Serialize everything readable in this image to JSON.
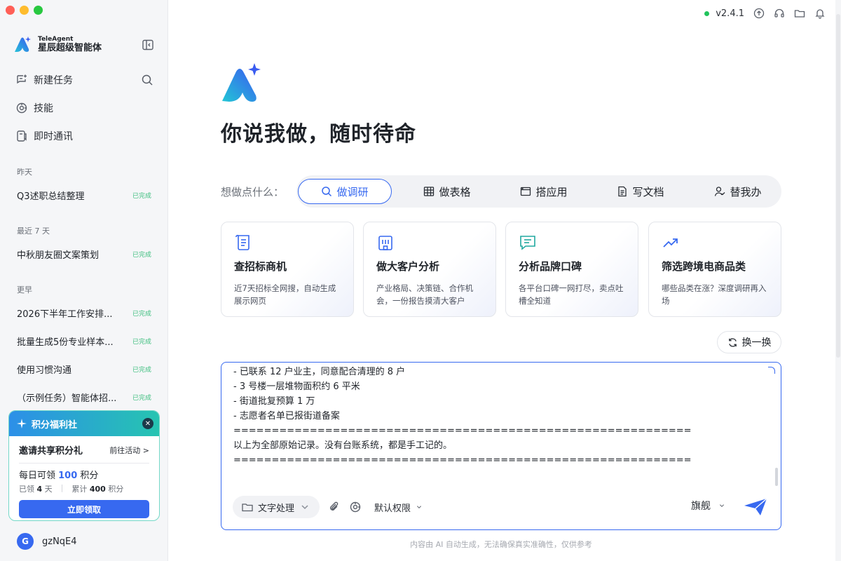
{
  "app": {
    "brand_en": "TeleAgent",
    "brand_cn": "星辰超级智能体",
    "version": "v2.4.1",
    "status_color": "#21c35c"
  },
  "sidebar": {
    "nav": [
      {
        "label": "新建任务",
        "icon": "new-task-icon"
      },
      {
        "label": "技能",
        "icon": "skill-icon"
      },
      {
        "label": "即时通讯",
        "icon": "chat-icon"
      }
    ],
    "sections": [
      {
        "label": "昨天",
        "items": [
          {
            "title": "Q3述职总结整理",
            "status": "已完成"
          }
        ]
      },
      {
        "label": "最近 7 天",
        "items": [
          {
            "title": "中秋朋友圈文案策划",
            "status": "已完成"
          }
        ]
      },
      {
        "label": "更早",
        "items": [
          {
            "title": "2026下半年工作安排...",
            "status": "已完成"
          },
          {
            "title": "批量生成5份专业样本...",
            "status": "已完成"
          },
          {
            "title": "使用习惯沟通",
            "status": "已完成"
          },
          {
            "title": "（示例任务）智能体招...",
            "status": "已完成"
          }
        ]
      }
    ],
    "promo": {
      "header": "积分福利社",
      "title": "邀请共享积分礼",
      "link": "前往活动 >",
      "daily_prefix": "每日可领 ",
      "daily_points": "100",
      "daily_suffix": " 积分",
      "claimed_prefix": "已领 ",
      "claimed_days": "4",
      "claimed_suffix": " 天",
      "total_prefix": "累计 ",
      "total_points": "400",
      "total_suffix": " 积分",
      "button": "立即领取"
    },
    "user": {
      "initial": "G",
      "name": "gzNqE4"
    }
  },
  "main": {
    "headline": "你说我做，随时待命",
    "prompt_label": "想做点什么：",
    "categories": [
      {
        "label": "做调研",
        "icon": "search-icon",
        "active": true
      },
      {
        "label": "做表格",
        "icon": "table-icon",
        "active": false
      },
      {
        "label": "搭应用",
        "icon": "app-icon",
        "active": false
      },
      {
        "label": "写文档",
        "icon": "document-icon",
        "active": false
      },
      {
        "label": "替我办",
        "icon": "user-check-icon",
        "active": false
      }
    ],
    "cards": [
      {
        "title": "查招标商机",
        "desc": "近7天招标全网搜，自动生成展示网页",
        "icon": "scroll-icon"
      },
      {
        "title": "做大客户分析",
        "desc": "产业格局、决策链、合作机会，一份报告摸清大客户",
        "icon": "building-icon"
      },
      {
        "title": "分析品牌口碑",
        "desc": "各平台口碑一网打尽，卖点吐槽全知道",
        "icon": "message-icon"
      },
      {
        "title": "筛选跨境电商品类",
        "desc": "哪些品类在涨？深度调研再入场",
        "icon": "trend-icon"
      }
    ],
    "refresh_label": "换一换",
    "composer": {
      "text": "- 已联系 12 户业主，同意配合清理的 8 户\n- 3 号楼一层堆物面积约 6 平米\n- 街道批复预算 1 万\n- 志愿者名单已报街道备案\n============================================================\n以上为全部原始记录。没有台账系统，都是手工记的。\n============================================================",
      "mode_label": "文字处理",
      "permission_label": "默认权限",
      "model_label": "旗舰"
    },
    "disclaimer": "内容由 AI 自动生成，无法确保真实准确性，仅供参考"
  },
  "colors": {
    "accent": "#3769f0",
    "done": "#3fbf7f"
  }
}
